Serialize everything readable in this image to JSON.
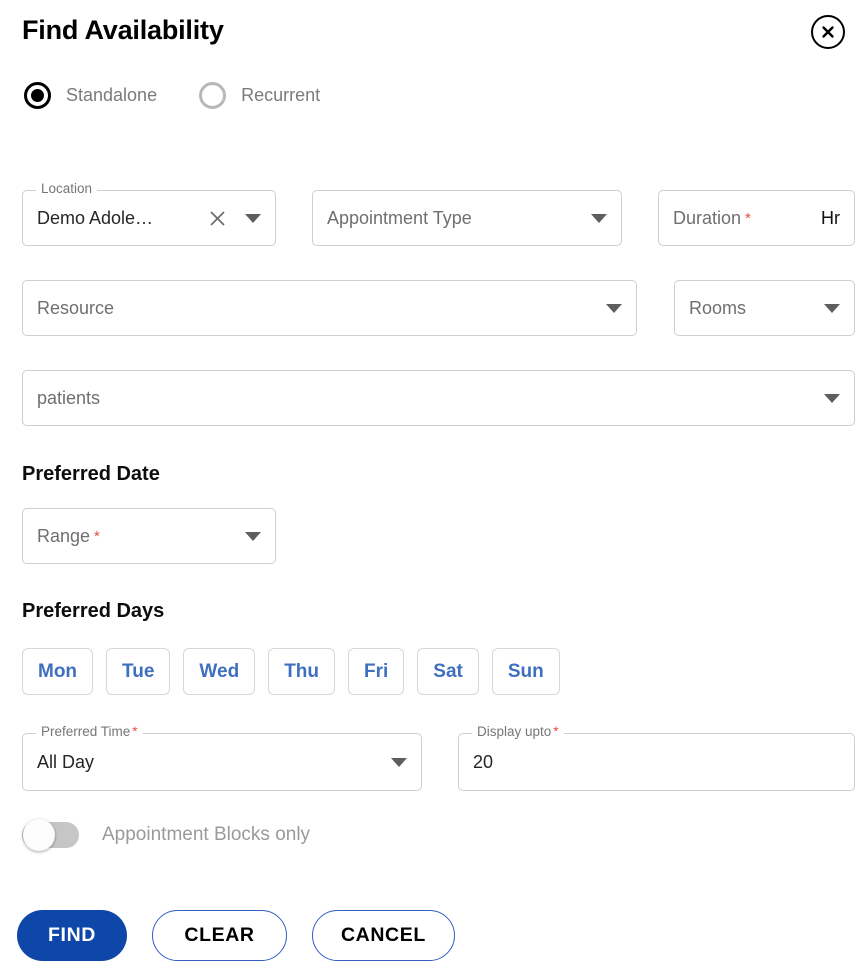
{
  "header": {
    "title": "Find Availability",
    "close_icon": "close-circle-icon"
  },
  "appointment_mode": {
    "selected": "Standalone",
    "options": [
      {
        "label": "Standalone",
        "checked": true
      },
      {
        "label": "Recurrent",
        "checked": false
      }
    ]
  },
  "fields": {
    "location": {
      "legend": "Location",
      "value": "Demo Adole…",
      "clear_icon": "clear-x-icon",
      "caret_icon": "chevron-down-icon"
    },
    "appointment_type": {
      "placeholder": "Appointment Type",
      "caret_icon": "chevron-down-icon"
    },
    "duration": {
      "placeholder": "Duration",
      "required_marker": "*",
      "suffix": "Hr"
    },
    "resource": {
      "placeholder": "Resource",
      "caret_icon": "chevron-down-icon"
    },
    "rooms": {
      "placeholder": "Rooms",
      "caret_icon": "chevron-down-icon"
    },
    "patients": {
      "placeholder": "patients",
      "caret_icon": "chevron-down-icon"
    },
    "date_range": {
      "placeholder": "Range",
      "required_marker": "*",
      "caret_icon": "chevron-down-icon"
    },
    "preferred_time": {
      "legend": "Preferred Time",
      "required_marker": "*",
      "value": "All Day",
      "caret_icon": "chevron-down-icon"
    },
    "display_upto": {
      "legend": "Display upto",
      "required_marker": "*",
      "value": "20"
    }
  },
  "sections": {
    "preferred_date_title": "Preferred Date",
    "preferred_days_title": "Preferred Days"
  },
  "preferred_days": [
    {
      "label": "Mon",
      "selected": false
    },
    {
      "label": "Tue",
      "selected": false
    },
    {
      "label": "Wed",
      "selected": false
    },
    {
      "label": "Thu",
      "selected": false
    },
    {
      "label": "Fri",
      "selected": false
    },
    {
      "label": "Sat",
      "selected": false
    },
    {
      "label": "Sun",
      "selected": false
    }
  ],
  "toggle": {
    "label": "Appointment Blocks only",
    "enabled": false
  },
  "actions": {
    "find": "FIND",
    "clear": "CLEAR",
    "cancel": "CANCEL"
  },
  "colors": {
    "primary_blue": "#0f47a8",
    "day_chip_blue": "#3f6fbf",
    "required_red": "#e8503a",
    "border_gray": "#cfcfcf",
    "placeholder_gray": "#6f6f6f"
  }
}
